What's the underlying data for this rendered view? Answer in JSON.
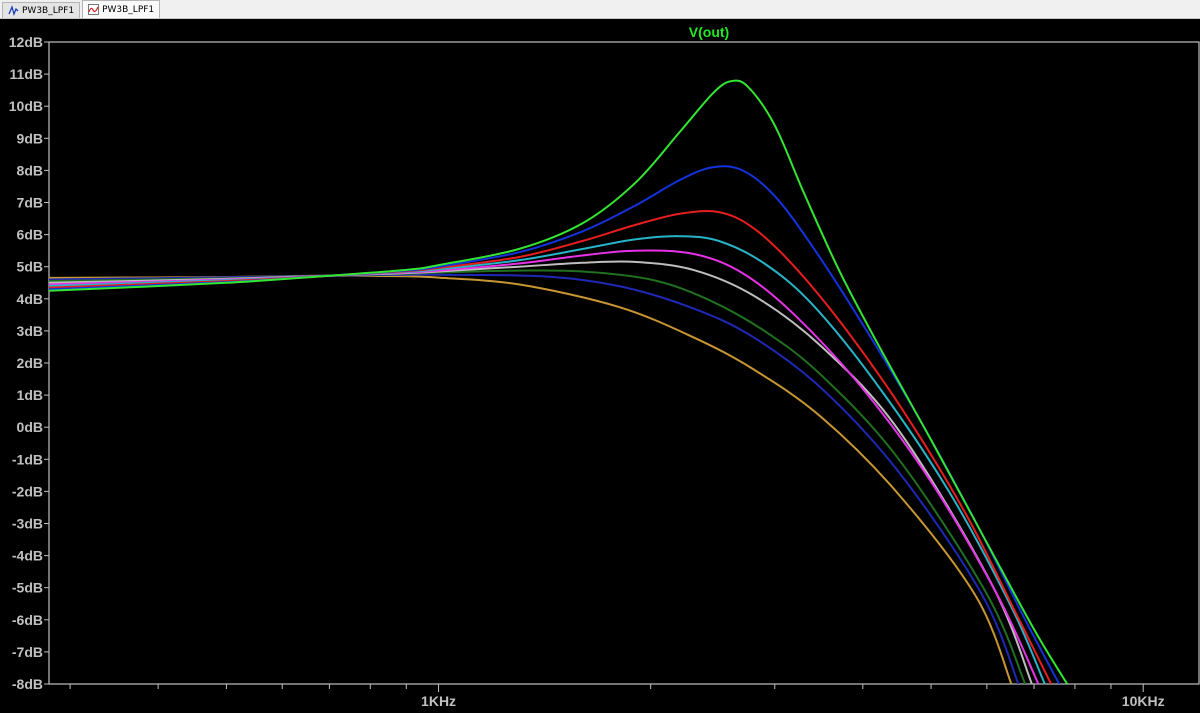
{
  "tabs": [
    {
      "label": "PW3B_LPF1",
      "icon": "schematic-icon",
      "active": false
    },
    {
      "label": "PW3B_LPF1",
      "icon": "waveform-icon",
      "active": true
    }
  ],
  "colors": {
    "background": "#000000",
    "axis": "#c0c0c0",
    "tick_label": "#c0c0c0",
    "title": "#22e822"
  },
  "chart_data": {
    "type": "line",
    "title": "V(out)",
    "xscale": "log",
    "xlim": [
      280,
      12000
    ],
    "ylim": [
      -8,
      12
    ],
    "grid": false,
    "ytick_values": [
      12,
      11,
      10,
      9,
      8,
      7,
      6,
      5,
      4,
      3,
      2,
      1,
      0,
      -1,
      -2,
      -3,
      -4,
      -5,
      -6,
      -7,
      -8
    ],
    "yticks": [
      "12dB",
      "11dB",
      "10dB",
      "9dB",
      "8dB",
      "7dB",
      "6dB",
      "5dB",
      "4dB",
      "3dB",
      "2dB",
      "1dB",
      "0dB",
      "-1dB",
      "-2dB",
      "-3dB",
      "-4dB",
      "-5dB",
      "-6dB",
      "-7dB",
      "-8dB"
    ],
    "xtick_values": [
      1000,
      10000
    ],
    "xticks": [
      "1KHz",
      "10KHz"
    ],
    "series": [
      {
        "color": "#c89632",
        "x": [
          280,
          500,
          700,
          900,
          1000,
          1300,
          1800,
          2300,
          2800,
          3500,
          4500,
          5800,
          6500
        ],
        "y": [
          4.65,
          4.68,
          4.72,
          4.7,
          4.66,
          4.45,
          3.75,
          2.8,
          1.8,
          0.3,
          -2.1,
          -5.3,
          -8.0
        ]
      },
      {
        "color": "#1e28b4",
        "x": [
          280,
          500,
          700,
          900,
          1000,
          1400,
          1800,
          2300,
          2800,
          3500,
          4500,
          5900,
          6650
        ],
        "y": [
          4.6,
          4.67,
          4.72,
          4.75,
          4.75,
          4.7,
          4.4,
          3.7,
          2.8,
          1.2,
          -1.4,
          -5.2,
          -8.0
        ]
      },
      {
        "color": "#207020",
        "x": [
          280,
          500,
          700,
          900,
          1000,
          1300,
          1600,
          2000,
          2400,
          2900,
          3500,
          4500,
          6000,
          6800
        ],
        "y": [
          4.55,
          4.64,
          4.72,
          4.78,
          4.82,
          4.88,
          4.85,
          4.6,
          4.0,
          3.0,
          1.6,
          -1.0,
          -5.2,
          -8.0
        ]
      },
      {
        "color": "#bebebe",
        "x": [
          280,
          500,
          700,
          900,
          1000,
          1300,
          1600,
          1900,
          2300,
          2800,
          3500,
          4500,
          6100,
          6950
        ],
        "y": [
          4.5,
          4.62,
          4.72,
          4.8,
          4.85,
          5.0,
          5.12,
          5.15,
          4.9,
          4.1,
          2.5,
          -0.1,
          -4.9,
          -8.0
        ]
      },
      {
        "color": "#e632e6",
        "x": [
          280,
          500,
          700,
          900,
          1000,
          1300,
          1600,
          1900,
          2300,
          2700,
          3200,
          4000,
          5000,
          6200,
          7100
        ],
        "y": [
          4.45,
          4.6,
          4.72,
          4.82,
          4.88,
          5.1,
          5.35,
          5.5,
          5.4,
          4.8,
          3.5,
          1.2,
          -1.7,
          -5.2,
          -8.0
        ]
      },
      {
        "color": "#28b4c8",
        "x": [
          280,
          500,
          700,
          900,
          1000,
          1300,
          1600,
          1900,
          2200,
          2500,
          2900,
          3400,
          4200,
          5300,
          6500,
          7250
        ],
        "y": [
          4.4,
          4.58,
          4.72,
          4.84,
          4.92,
          5.2,
          5.55,
          5.85,
          5.95,
          5.8,
          5.1,
          3.8,
          1.3,
          -2.0,
          -5.6,
          -8.0
        ]
      },
      {
        "color": "#e61e1e",
        "x": [
          280,
          500,
          700,
          900,
          1000,
          1300,
          1600,
          1900,
          2200,
          2500,
          2800,
          3200,
          3800,
          4600,
          5600,
          6600,
          7400
        ],
        "y": [
          4.35,
          4.55,
          4.72,
          4.86,
          4.96,
          5.3,
          5.8,
          6.3,
          6.65,
          6.7,
          6.2,
          5.0,
          3.0,
          0.4,
          -2.7,
          -5.8,
          -8.0
        ]
      },
      {
        "color": "#1432dc",
        "x": [
          280,
          500,
          700,
          900,
          1000,
          1300,
          1600,
          1900,
          2200,
          2450,
          2700,
          3000,
          3400,
          4000,
          4800,
          5800,
          6800,
          7600
        ],
        "y": [
          4.3,
          4.52,
          4.72,
          4.88,
          5.0,
          5.45,
          6.1,
          6.9,
          7.7,
          8.1,
          8.0,
          7.2,
          5.6,
          3.2,
          0.3,
          -3.0,
          -6.0,
          -8.0
        ]
      },
      {
        "color": "#32e632",
        "x": [
          280,
          500,
          700,
          900,
          1000,
          1300,
          1600,
          1900,
          2200,
          2450,
          2600,
          2750,
          3000,
          3300,
          3700,
          4200,
          5000,
          6000,
          7000,
          7800
        ],
        "y": [
          4.25,
          4.5,
          4.72,
          4.9,
          5.05,
          5.55,
          6.35,
          7.6,
          9.2,
          10.4,
          10.78,
          10.6,
          9.4,
          7.3,
          4.9,
          2.6,
          -0.4,
          -3.6,
          -6.3,
          -8.0
        ]
      }
    ]
  }
}
